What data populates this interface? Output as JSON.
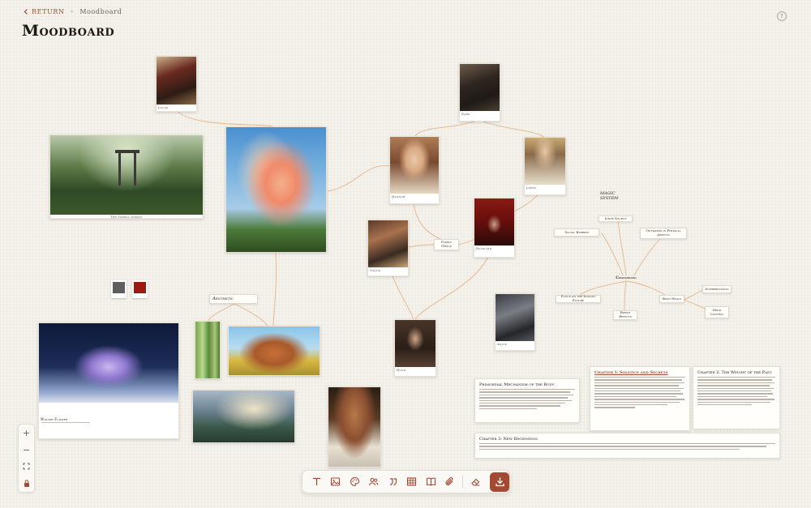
{
  "nav": {
    "return_label": "RETURN",
    "separator": "•",
    "breadcrumb": "Moodboard"
  },
  "page": {
    "title": "Moodboard",
    "help_icon": "?"
  },
  "colors": {
    "accent": "#a44a33",
    "line": "#e4b58a",
    "swatch_1": "#5f5f5f",
    "swatch_2": "#9b1a12"
  },
  "labels": {
    "aesthetic": "Aesthetic",
    "magic_system": "MAGIC SYSTEM",
    "family_group": "Family Group"
  },
  "mindmap": {
    "center": "Channeling",
    "nodes": [
      "Inner Source",
      "Social Barrier",
      "Outwards in Physical Aspects",
      "Focus on the Instant Future",
      "Body Heals",
      "Interpretation",
      "Mind Control",
      "Ripple Effects"
    ]
  },
  "cards": {
    "portrait_1": "Lucas",
    "portrait_2": "Dark",
    "girl": "Hannah",
    "blonde": "Lewis",
    "child": "Young",
    "red_hood": "Rosalind",
    "shadow": "Annie",
    "boy": "Hugh",
    "torii_caption": "The forest temple",
    "flower_caption": "Winter Flower"
  },
  "docs": {
    "doc1_title": "Primordial Mechanism of the Body",
    "doc2_title": "Chapter I: Solstice and Secrets",
    "doc3_title": "Chapter 2: The Weight of the Past",
    "doc4_title": "Chapter 3: New Beginnings"
  },
  "zoom": {
    "in": "+",
    "out": "−",
    "fit": "fit-icon",
    "lock": "lock-icon"
  },
  "toolbar": [
    "text-icon",
    "image-icon",
    "palette-icon",
    "characters-icon",
    "quote-icon",
    "table-icon",
    "book-icon",
    "attachment-icon",
    "eraser-icon",
    "export-icon"
  ]
}
